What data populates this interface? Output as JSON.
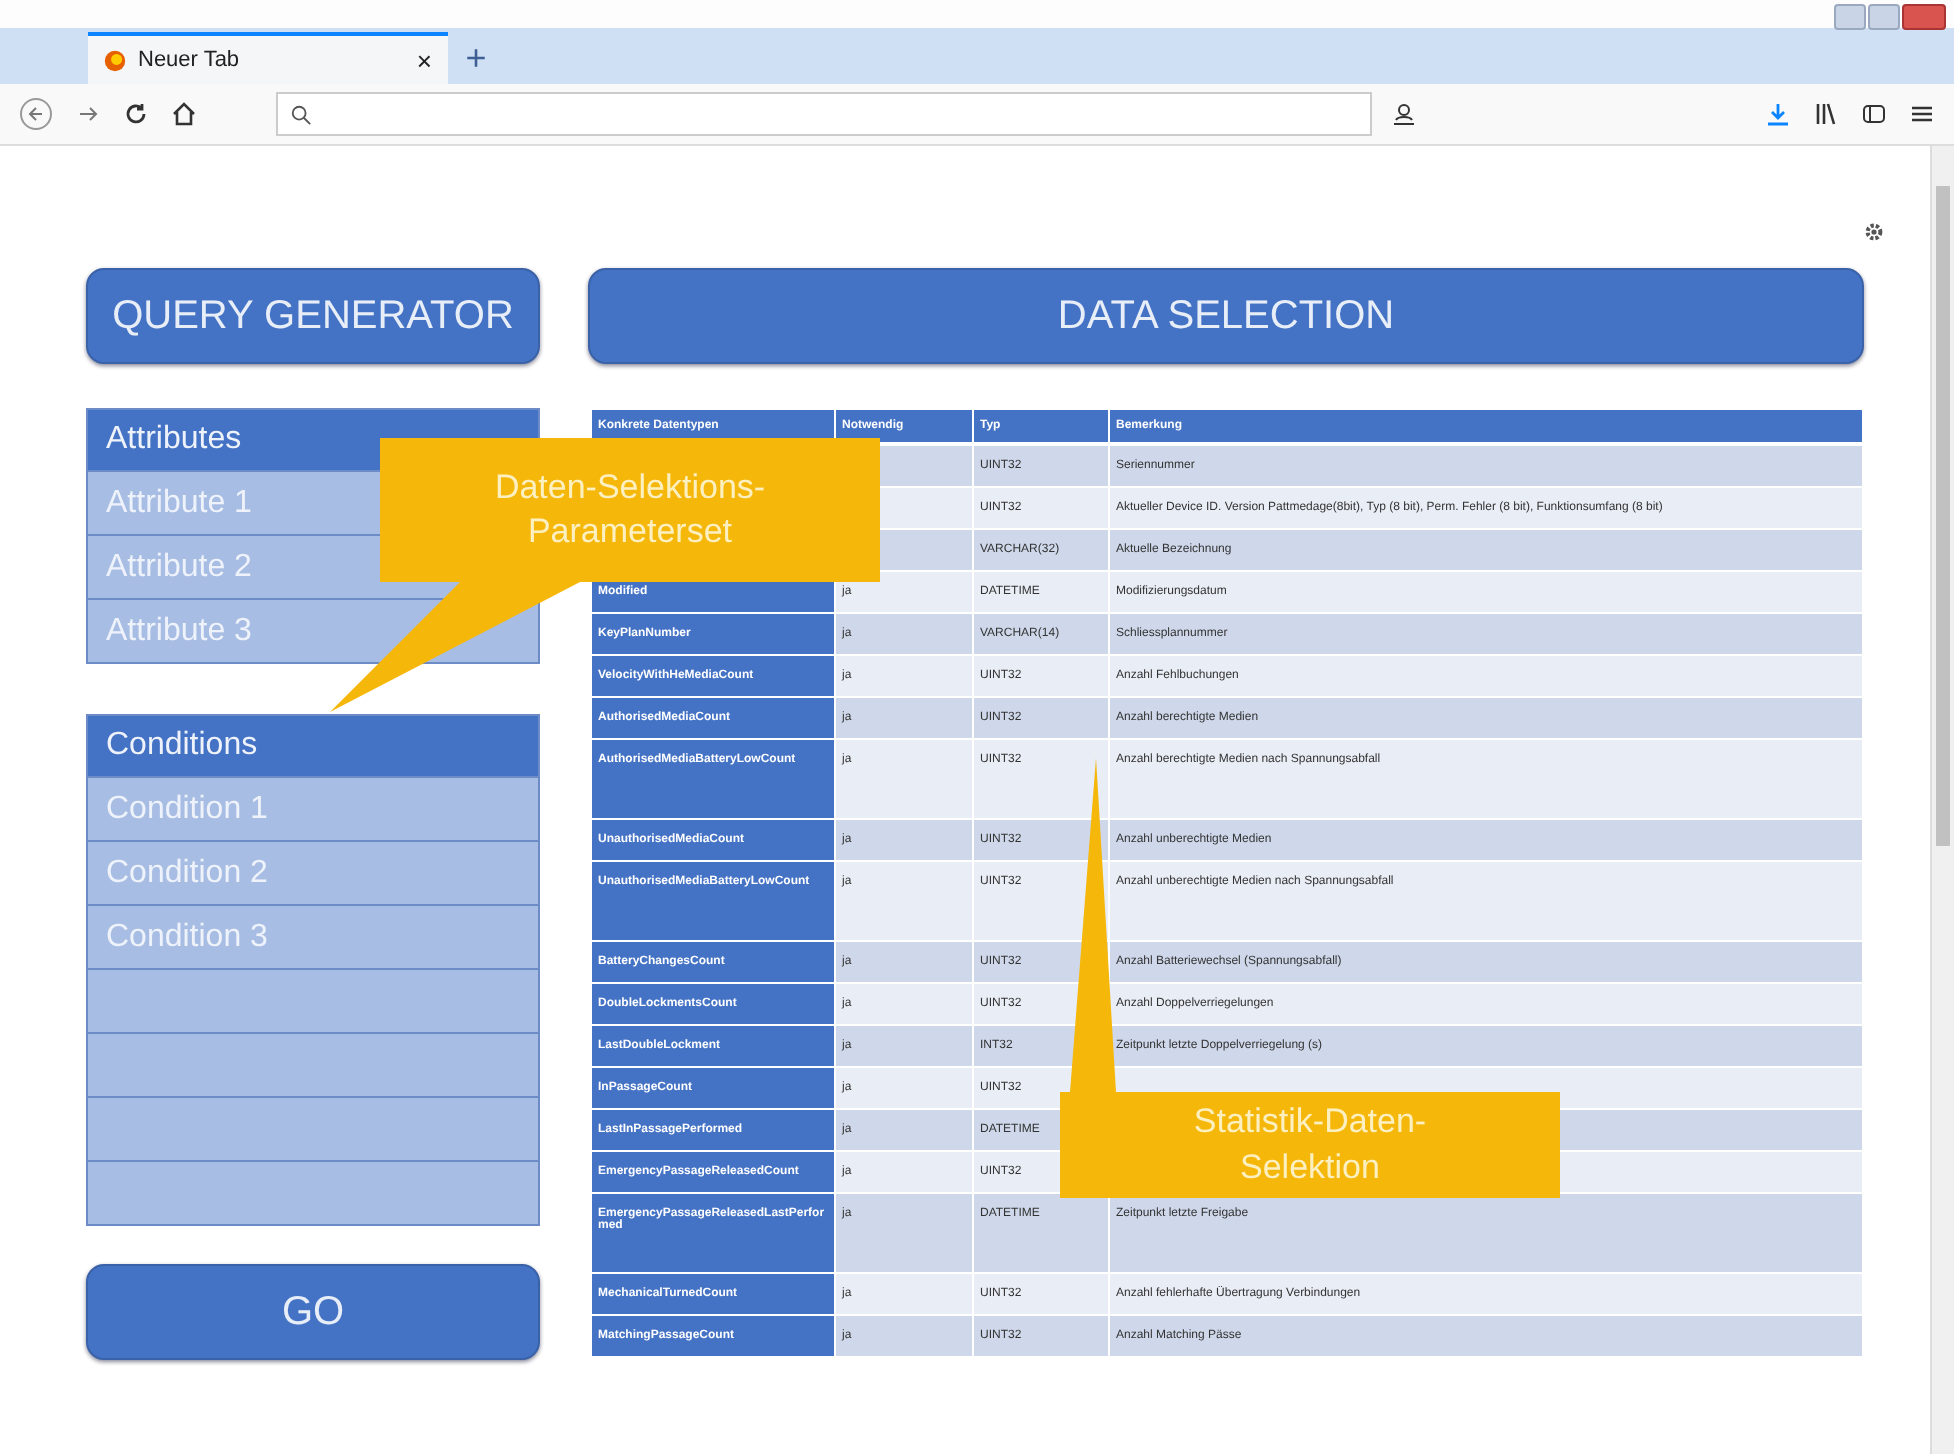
{
  "browser": {
    "tab": {
      "title": "Neuer Tab",
      "close": "×",
      "new_tab": "+",
      "selected": true
    }
  },
  "sidebar": {
    "title": "QUERY GENERATOR",
    "groups": [
      {
        "header": "Attributes",
        "items": [
          {
            "kind": "item",
            "label": "Attribute 1"
          },
          {
            "kind": "item",
            "label": "Attribute 2"
          },
          {
            "kind": "item",
            "label": "Attribute 3"
          }
        ]
      },
      {
        "header": "Conditions",
        "items": [
          {
            "kind": "item",
            "label": "Condition 1"
          },
          {
            "kind": "item",
            "label": "Condition 2"
          },
          {
            "kind": "item",
            "label": "Condition 3"
          },
          {
            "kind": "blank"
          },
          {
            "kind": "blank"
          },
          {
            "kind": "blank"
          },
          {
            "kind": "blank"
          }
        ]
      }
    ],
    "go": "GO"
  },
  "data_selection": {
    "title": "DATA SELECTION",
    "table": {
      "columns": [
        "Konkrete Datentypen",
        "Notwendig",
        "Typ",
        "Bemerkung"
      ],
      "rows": [
        {
          "type": "UINT32",
          "remark": "Seriennummer",
          "tall": false
        },
        {
          "type": "UINT32",
          "remark": "Aktueller Device ID. Version Pattmedage(8bit), Typ (8 bit), Perm. Fehler (8 bit), Funktionsumfang (8 bit)",
          "tall": false
        },
        {
          "type": "VARCHAR(32)",
          "remark": "Aktuelle Bezeichnung",
          "tall": false
        },
        {
          "name": "Modified",
          "required": "ja",
          "type": "DATETIME",
          "remark": "Modifizierungsdatum",
          "tall": false
        },
        {
          "name": "KeyPlanNumber",
          "required": "ja",
          "type": "VARCHAR(14)",
          "remark": "Schliessplannummer",
          "tall": false
        },
        {
          "name": "VelocityWithHeMediaCount",
          "required": "ja",
          "type": "UINT32",
          "remark": "Anzahl Fehlbuchungen",
          "tall": false
        },
        {
          "name": "AuthorisedMediaCount",
          "required": "ja",
          "type": "UINT32",
          "remark": "Anzahl berechtigte Medien",
          "tall": false
        },
        {
          "name": "AuthorisedMediaBatteryLowCount",
          "required": "ja",
          "type": "UINT32",
          "remark": "Anzahl berechtigte Medien nach Spannungsabfall",
          "tall": true
        },
        {
          "name": "UnauthorisedMediaCount",
          "required": "ja",
          "type": "UINT32",
          "remark": "Anzahl unberechtigte Medien",
          "tall": false
        },
        {
          "name": "UnauthorisedMediaBatteryLowCount",
          "required": "ja",
          "type": "UINT32",
          "remark": "Anzahl unberechtigte Medien nach Spannungsabfall",
          "tall": true
        },
        {
          "name": "BatteryChangesCount",
          "required": "ja",
          "type": "UINT32",
          "remark": "Anzahl Batteriewechsel (Spannungsabfall)",
          "tall": false
        },
        {
          "name": "DoubleLockmentsCount",
          "required": "ja",
          "type": "UINT32",
          "remark": "Anzahl Doppelverriegelungen",
          "tall": false
        },
        {
          "name": "LastDoubleLockment",
          "required": "ja",
          "type": "INT32",
          "remark": "Zeitpunkt letzte Doppelverriegelung (s)",
          "tall": false
        },
        {
          "name": "InPassageCount",
          "required": "ja",
          "type": "UINT32",
          "tall": false
        },
        {
          "name": "LastInPassagePerformed",
          "required": "ja",
          "type": "DATETIME",
          "tall": false
        },
        {
          "name": "EmergencyPassageReleasedCount",
          "required": "ja",
          "type": "UINT32",
          "tall": false
        },
        {
          "name": "EmergencyPassageReleasedLastPerformed",
          "required": "ja",
          "type": "DATETIME",
          "remark": "Zeitpunkt letzte Freigabe",
          "tall": true
        },
        {
          "name": "MechanicalTurnedCount",
          "required": "ja",
          "type": "UINT32",
          "remark": "Anzahl fehlerhafte Übertragung Verbindungen",
          "tall": false
        },
        {
          "name": "MatchingPassageCount",
          "required": "ja",
          "type": "UINT32",
          "remark": "Anzahl Matching Pässe",
          "tall": false
        }
      ]
    }
  },
  "callouts": [
    {
      "kind": "parameters",
      "lines": [
        "Daten-Selektions-",
        "Parameterset"
      ]
    },
    {
      "kind": "statistics",
      "lines": [
        "Statistik-Daten-",
        "Selektion"
      ]
    }
  ]
}
